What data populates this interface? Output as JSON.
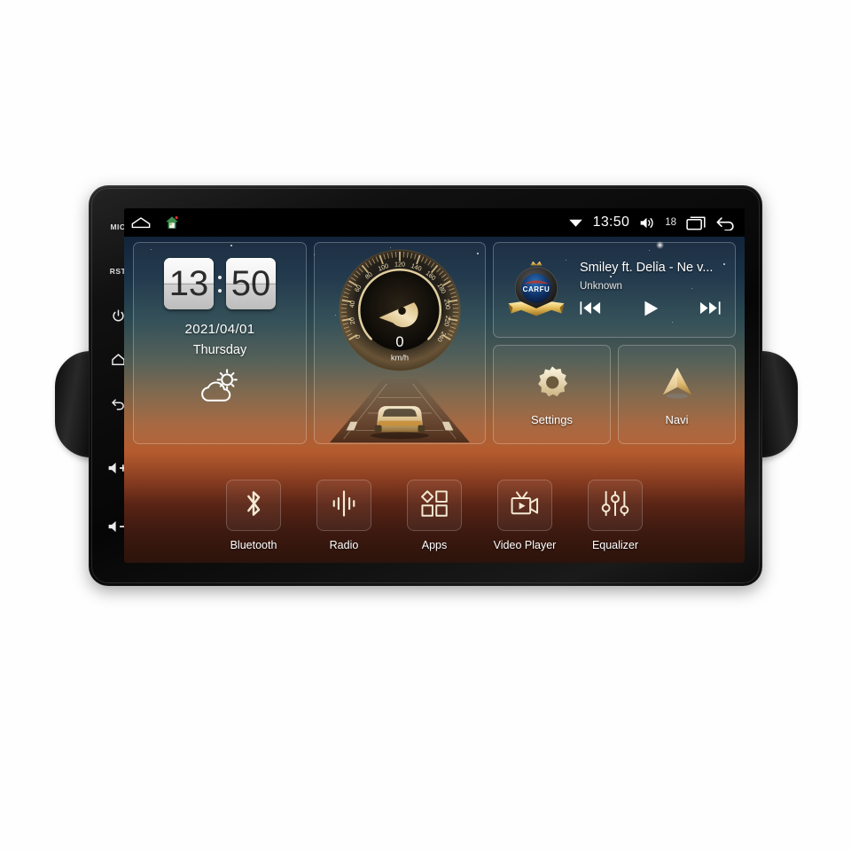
{
  "device": {
    "type": "android-car-head-unit",
    "bezel_keys": [
      {
        "name": "mic",
        "label": "MIC",
        "icon": "mic-text"
      },
      {
        "name": "reset",
        "label": "RST",
        "icon": "rst-text"
      },
      {
        "name": "power",
        "label": "",
        "icon": "power-icon"
      },
      {
        "name": "home",
        "label": "",
        "icon": "home-icon"
      },
      {
        "name": "back",
        "label": "",
        "icon": "back-icon"
      },
      {
        "name": "volume-up",
        "label": "",
        "icon": "volume-up-icon"
      },
      {
        "name": "volume-down",
        "label": "",
        "icon": "volume-down-icon"
      }
    ]
  },
  "statusbar": {
    "left_icons": [
      {
        "name": "recents-outline-icon"
      },
      {
        "name": "home-app-icon"
      }
    ],
    "wifi_icon": "wifi-icon",
    "time": "13:50",
    "volume_icon": "volume-icon",
    "volume_level": "18",
    "recents_icon": "recents-icon",
    "back_icon": "back-arrow-icon"
  },
  "clock_widget": {
    "hour": "13",
    "minute": "50",
    "date": "2021/04/01",
    "weekday": "Thursday",
    "weather_icon": "partly-cloudy-icon"
  },
  "speedometer": {
    "value": "0",
    "unit": "km/h",
    "min": 0,
    "max": 240,
    "tick_step": 20,
    "tick_labels": [
      "0",
      "20",
      "40",
      "60",
      "80",
      "100",
      "120",
      "140",
      "160",
      "180",
      "200",
      "220",
      "240"
    ],
    "accent_color": "#e8c98a"
  },
  "music": {
    "title": "Smiley ft. Delia - Ne v...",
    "artist": "Unknown",
    "album_art": {
      "brand": "CARFU",
      "crown_icon": "crown-icon",
      "ribbon_icon": "ribbon-icon"
    },
    "controls": [
      {
        "name": "previous-track-button",
        "icon": "previous-icon"
      },
      {
        "name": "play-button",
        "icon": "play-icon"
      },
      {
        "name": "next-track-button",
        "icon": "next-icon"
      }
    ]
  },
  "tiles": [
    {
      "name": "settings-tile",
      "label": "Settings",
      "icon": "gear-icon"
    },
    {
      "name": "navi-tile",
      "label": "Navi",
      "icon": "navigation-arrow-icon"
    }
  ],
  "dock": [
    {
      "name": "bluetooth",
      "label": "Bluetooth",
      "icon": "bluetooth-icon"
    },
    {
      "name": "radio",
      "label": "Radio",
      "icon": "radio-waveform-icon"
    },
    {
      "name": "apps",
      "label": "Apps",
      "icon": "apps-grid-icon"
    },
    {
      "name": "video-player",
      "label": "Video Player",
      "icon": "video-camera-icon"
    },
    {
      "name": "equalizer",
      "label": "Equalizer",
      "icon": "equalizer-sliders-icon"
    }
  ],
  "colors": {
    "accent_gold": "#e8c98a",
    "sky_top": "#12243a",
    "sunset_mid": "#b55c2e",
    "ground_bottom": "#2c130b",
    "text": "#ffffff"
  }
}
